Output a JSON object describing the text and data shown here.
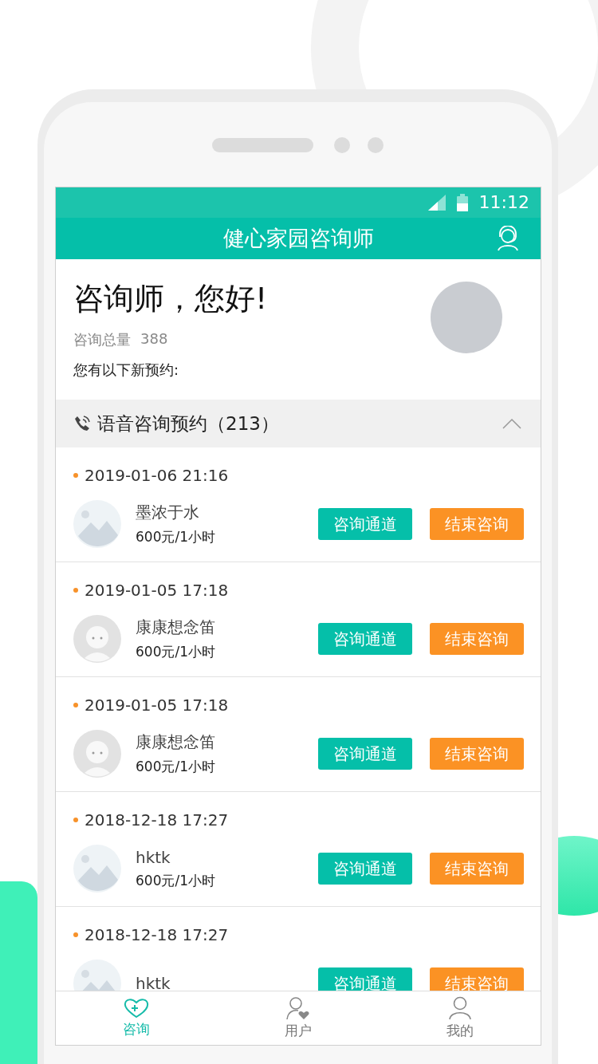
{
  "status_bar": {
    "time": "11:12"
  },
  "header": {
    "title": "健心家园咨询师"
  },
  "greeting": {
    "title": "咨询师，您好!",
    "total_label": "咨询总量",
    "total_value": "388",
    "note": "您有以下新预约:"
  },
  "section": {
    "title": "语音咨询预约（213）",
    "expanded": true
  },
  "appointments": [
    {
      "date": "2019-01-06 21:16",
      "name": "墨浓于水",
      "price": "600元/1小时",
      "kind": "landscape",
      "actions": [
        "咨询通道",
        "结束咨询"
      ]
    },
    {
      "date": "2019-01-05 17:18",
      "name": "康康想念笛",
      "price": "600元/1小时",
      "kind": "cartoon",
      "actions": [
        "咨询通道",
        "结束咨询"
      ]
    },
    {
      "date": "2019-01-05 17:18",
      "name": "康康想念笛",
      "price": "600元/1小时",
      "kind": "cartoon",
      "actions": [
        "咨询通道",
        "结束咨询"
      ]
    },
    {
      "date": "2018-12-18 17:27",
      "name": "hktk",
      "price": "600元/1小时",
      "kind": "landscape",
      "actions": [
        "咨询通道",
        "结束咨询"
      ]
    },
    {
      "date": "2018-12-18 17:27",
      "name": "hktk",
      "kind": "landscape",
      "actions": [
        "咨询通道",
        "结束咨询"
      ]
    }
  ],
  "tabs": [
    {
      "label": "咨询",
      "selected": true
    },
    {
      "label": "用户",
      "selected": false
    },
    {
      "label": "我的",
      "selected": false
    }
  ]
}
